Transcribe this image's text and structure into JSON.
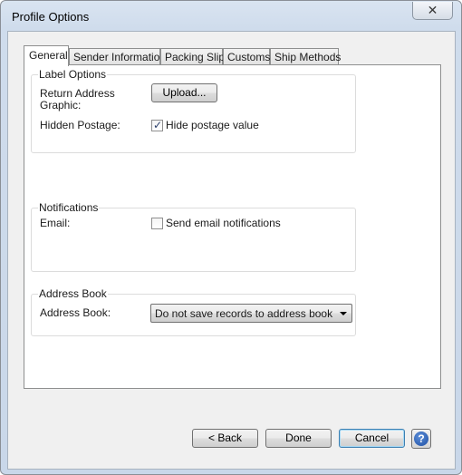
{
  "window": {
    "title": "Profile Options",
    "close_glyph": "✕"
  },
  "tabs": [
    {
      "label": "General"
    },
    {
      "label": "Sender Information"
    },
    {
      "label": "Packing Slip"
    },
    {
      "label": "Customs"
    },
    {
      "label": "Ship Methods"
    }
  ],
  "label_options": {
    "group_label": "Label Options",
    "return_address_label_line1": "Return Address",
    "return_address_label_line2": "Graphic:",
    "upload_button": "Upload...",
    "hidden_postage_label": "Hidden Postage:",
    "hide_postage_checkbox": {
      "label": "Hide postage value",
      "checked": true
    }
  },
  "notifications": {
    "group_label": "Notifications",
    "email_label": "Email:",
    "send_email_checkbox": {
      "label": "Send email notifications",
      "checked": false
    }
  },
  "address_book": {
    "group_label": "Address Book",
    "address_book_label": "Address Book:",
    "select_value": "Do not save records to address book"
  },
  "footer": {
    "back_button": "< Back",
    "done_button": "Done",
    "cancel_button": "Cancel",
    "help_glyph": "?"
  },
  "icons": {
    "close": "close-icon",
    "help": "help-icon",
    "dropdown": "chevron-down-icon",
    "check": "checkmark-icon"
  },
  "colors": {
    "title_bar": "#cfdcec",
    "client_background": "#f0f0f0",
    "help_icon": "#1d4fa4",
    "default_button_border": "#3c7fb1"
  }
}
